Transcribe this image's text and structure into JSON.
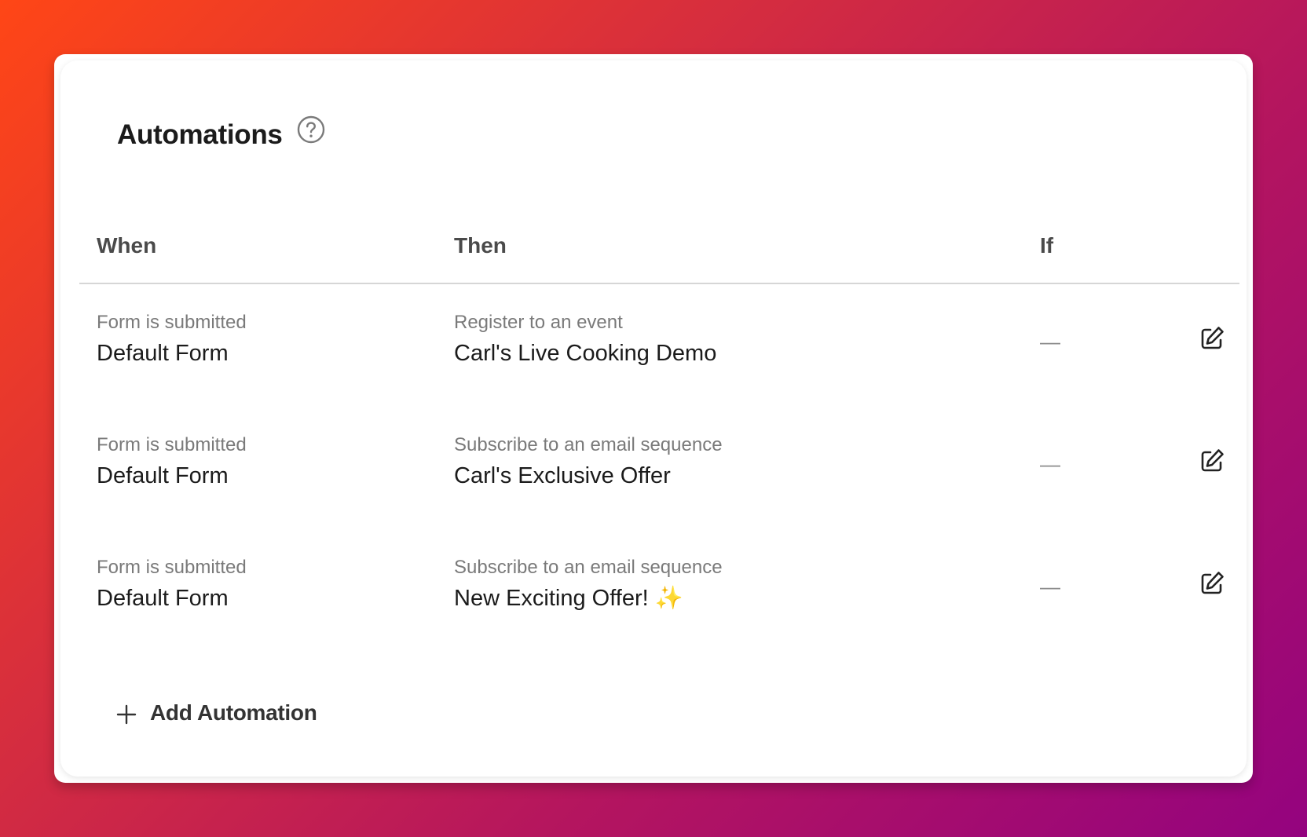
{
  "colors": {
    "accent_gradient_start": "#ff4616",
    "accent_gradient_end": "#94037f",
    "card_background": "#ffffff",
    "text_primary": "#1b1b1b",
    "text_secondary": "#7a7a7a"
  },
  "panel": {
    "title": "Automations",
    "help_icon": "question-circle-icon"
  },
  "table": {
    "columns": [
      "When",
      "Then",
      "If"
    ],
    "rows": [
      {
        "when_label": "Form is submitted",
        "when_value": "Default Form",
        "then_label": "Register to an event",
        "then_value": "Carl's Live Cooking Demo",
        "if_value": "—",
        "edit_icon": "edit-icon"
      },
      {
        "when_label": "Form is submitted",
        "when_value": "Default Form",
        "then_label": "Subscribe to an email sequence",
        "then_value": "Carl's Exclusive Offer",
        "if_value": "—",
        "edit_icon": "edit-icon"
      },
      {
        "when_label": "Form is submitted",
        "when_value": "Default Form",
        "then_label": "Subscribe to an email sequence",
        "then_value": "New Exciting Offer! ✨",
        "if_value": "—",
        "edit_icon": "edit-icon"
      }
    ]
  },
  "add_button": {
    "label": "Add Automation",
    "icon": "plus-icon"
  }
}
